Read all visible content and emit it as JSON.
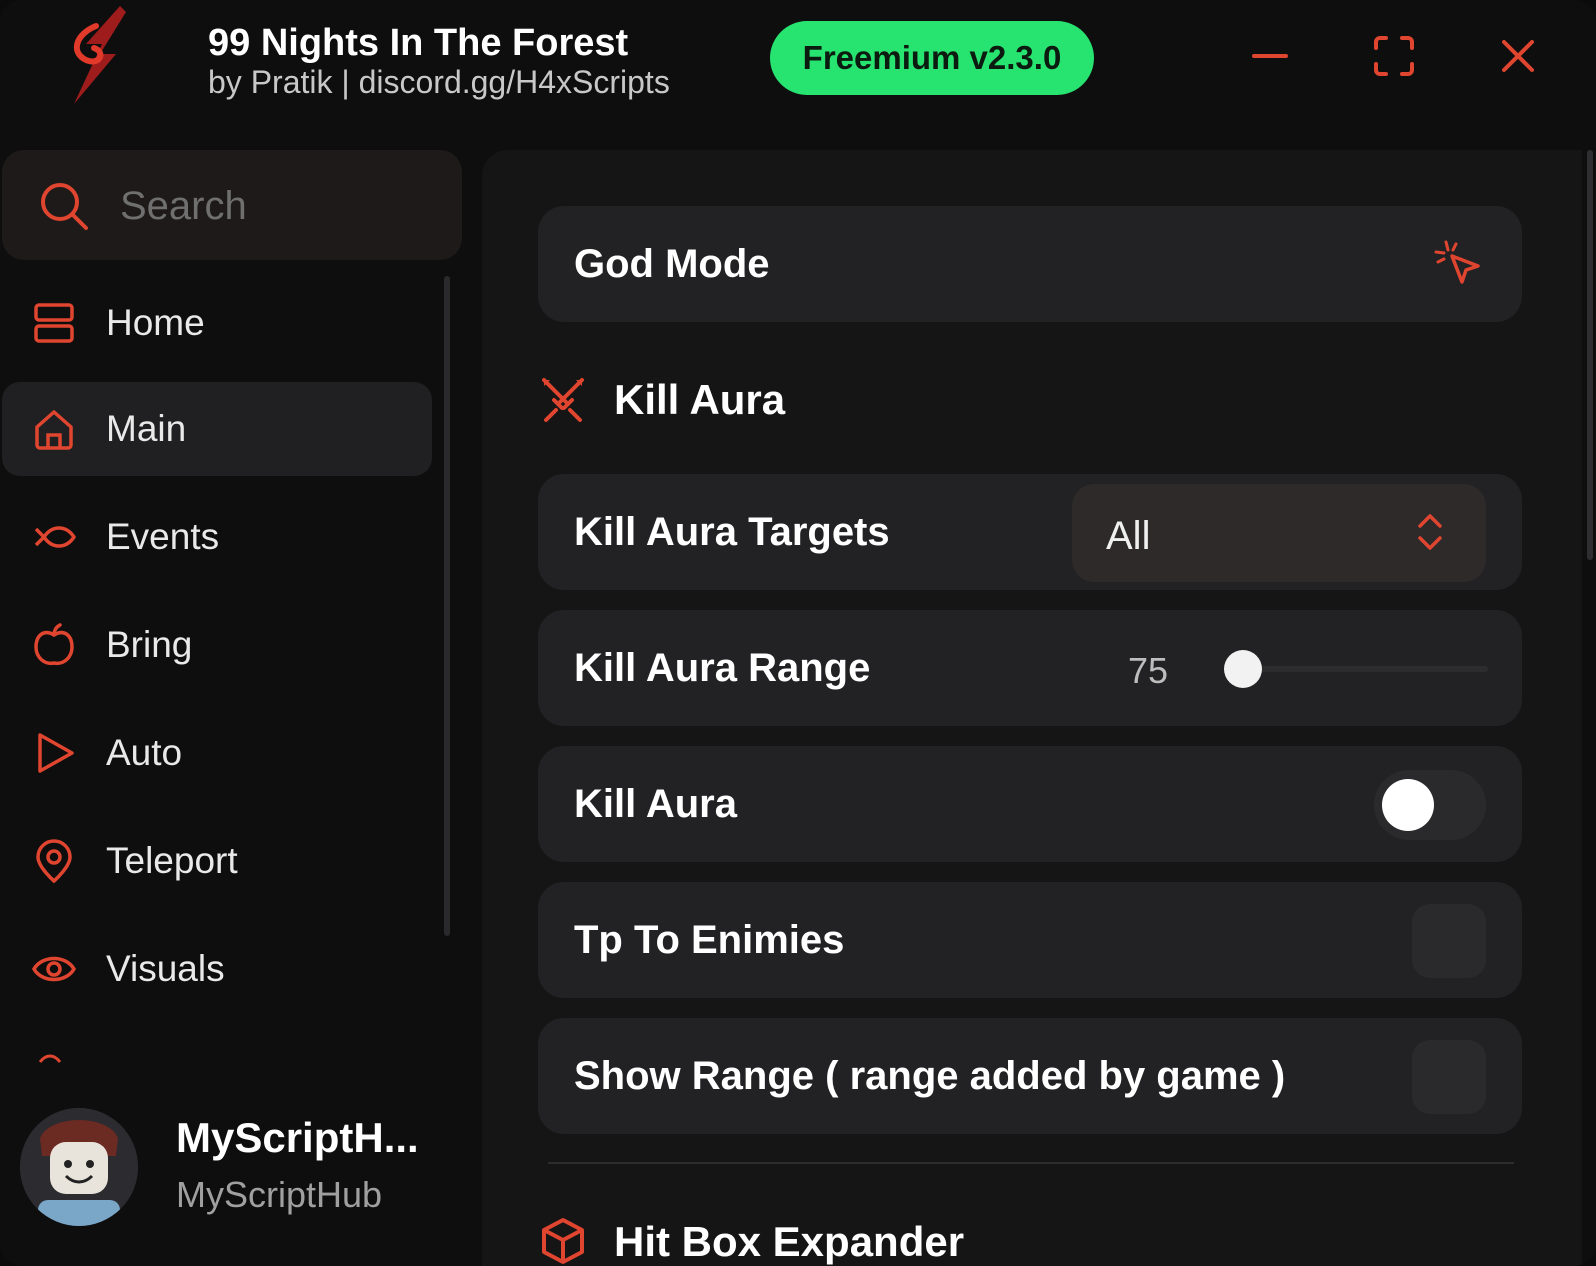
{
  "app": {
    "title": "99 Nights In The Forest",
    "subtitle": "by Pratik | discord.gg/H4xScripts",
    "badge": "Freemium v2.3.0",
    "accent": "#e0452f",
    "badge_color": "#27e36f"
  },
  "window_controls": {
    "minimize_icon": "minimize-icon",
    "maximize_icon": "maximize-icon",
    "close_icon": "close-icon"
  },
  "search": {
    "placeholder": "Search",
    "value": ""
  },
  "sidebar": {
    "items": [
      {
        "label": "Home",
        "icon": "layout-icon",
        "active": false
      },
      {
        "label": "Main",
        "icon": "home-icon",
        "active": true
      },
      {
        "label": "Events",
        "icon": "fish-icon",
        "active": false
      },
      {
        "label": "Bring",
        "icon": "apple-icon",
        "active": false
      },
      {
        "label": "Auto",
        "icon": "play-icon",
        "active": false
      },
      {
        "label": "Teleport",
        "icon": "map-pin-icon",
        "active": false
      },
      {
        "label": "Visuals",
        "icon": "eye-icon",
        "active": false
      }
    ]
  },
  "profile": {
    "name": "MyScriptH...",
    "username": "MyScriptHub"
  },
  "main": {
    "god_mode": {
      "label": "God Mode",
      "icon": "pointer-click-icon"
    },
    "kill_aura_section": {
      "title": "Kill Aura",
      "icon": "crossed-swords-icon"
    },
    "kill_aura_targets": {
      "label": "Kill Aura Targets",
      "value": "All"
    },
    "kill_aura_range": {
      "label": "Kill Aura Range",
      "value": "75",
      "fraction": 0.02
    },
    "kill_aura_toggle": {
      "label": "Kill Aura",
      "on": false
    },
    "tp_to_enemies": {
      "label": "Tp To Enimies",
      "checked": false
    },
    "show_range": {
      "label": "Show Range ( range added by game )",
      "checked": false
    },
    "next_section": {
      "title": "Hit Box Expander",
      "icon": "box-icon"
    }
  }
}
